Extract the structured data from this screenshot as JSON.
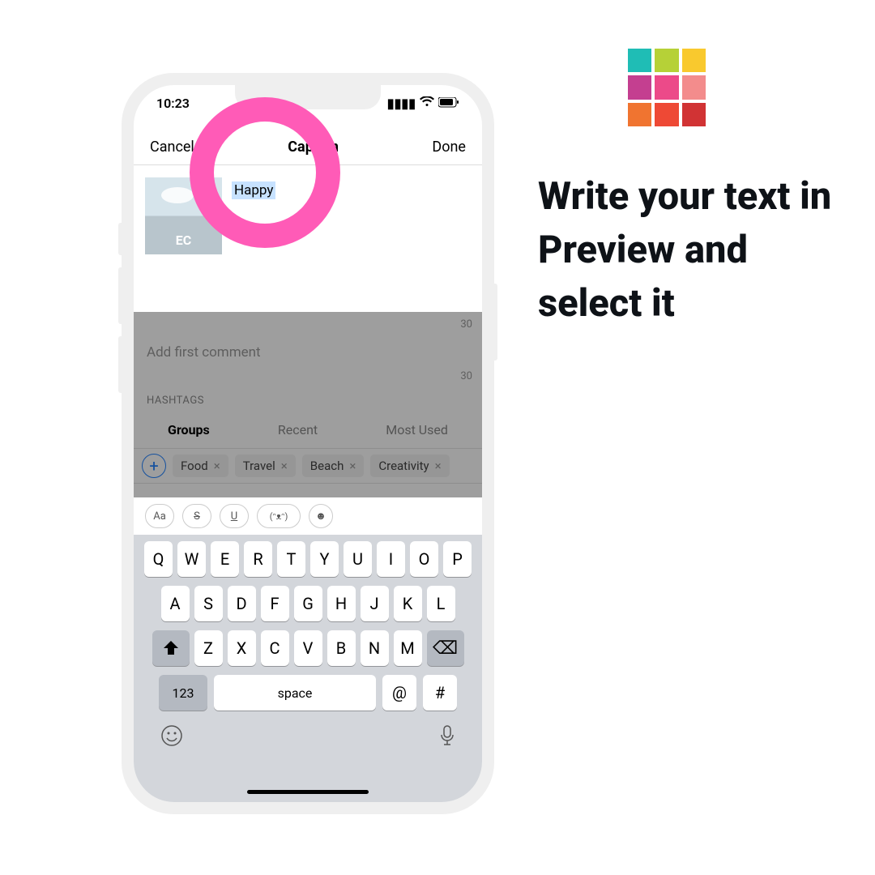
{
  "logo_colors": [
    "#1fbdb5",
    "#b6d137",
    "#f9c92e",
    "#c43f90",
    "#ec4a89",
    "#f38c8c",
    "#f07430",
    "#ee4935",
    "#d13334"
  ],
  "headline": "Write your text in Preview and select it",
  "status": {
    "time": "10:23"
  },
  "nav": {
    "cancel": "Cancel",
    "title": "Caption",
    "done": "Done"
  },
  "caption": {
    "thumb_text": "EC",
    "selected_text": "Happy"
  },
  "comment": {
    "count1": "30",
    "placeholder": "Add first comment",
    "count2": "30"
  },
  "hashtags": {
    "section_label": "HASHTAGS",
    "tabs": [
      "Groups",
      "Recent",
      "Most Used"
    ],
    "chips": [
      "Food",
      "Travel",
      "Beach",
      "Creativity"
    ]
  },
  "fmt": {
    "aa": "Aa",
    "strike": "S",
    "under": "U",
    "kaomoji": "(ᵔᴥᵔ)",
    "emoji": "☻"
  },
  "kb": {
    "row1": [
      "Q",
      "W",
      "E",
      "R",
      "T",
      "Y",
      "U",
      "I",
      "O",
      "P"
    ],
    "row2": [
      "A",
      "S",
      "D",
      "F",
      "G",
      "H",
      "J",
      "K",
      "L"
    ],
    "row3": [
      "Z",
      "X",
      "C",
      "V",
      "B",
      "N",
      "M"
    ],
    "shift": "⇧",
    "del": "⌫",
    "num": "123",
    "space": "space",
    "at": "@",
    "hash": "#",
    "emoji": "☺",
    "mic": "🎤"
  }
}
